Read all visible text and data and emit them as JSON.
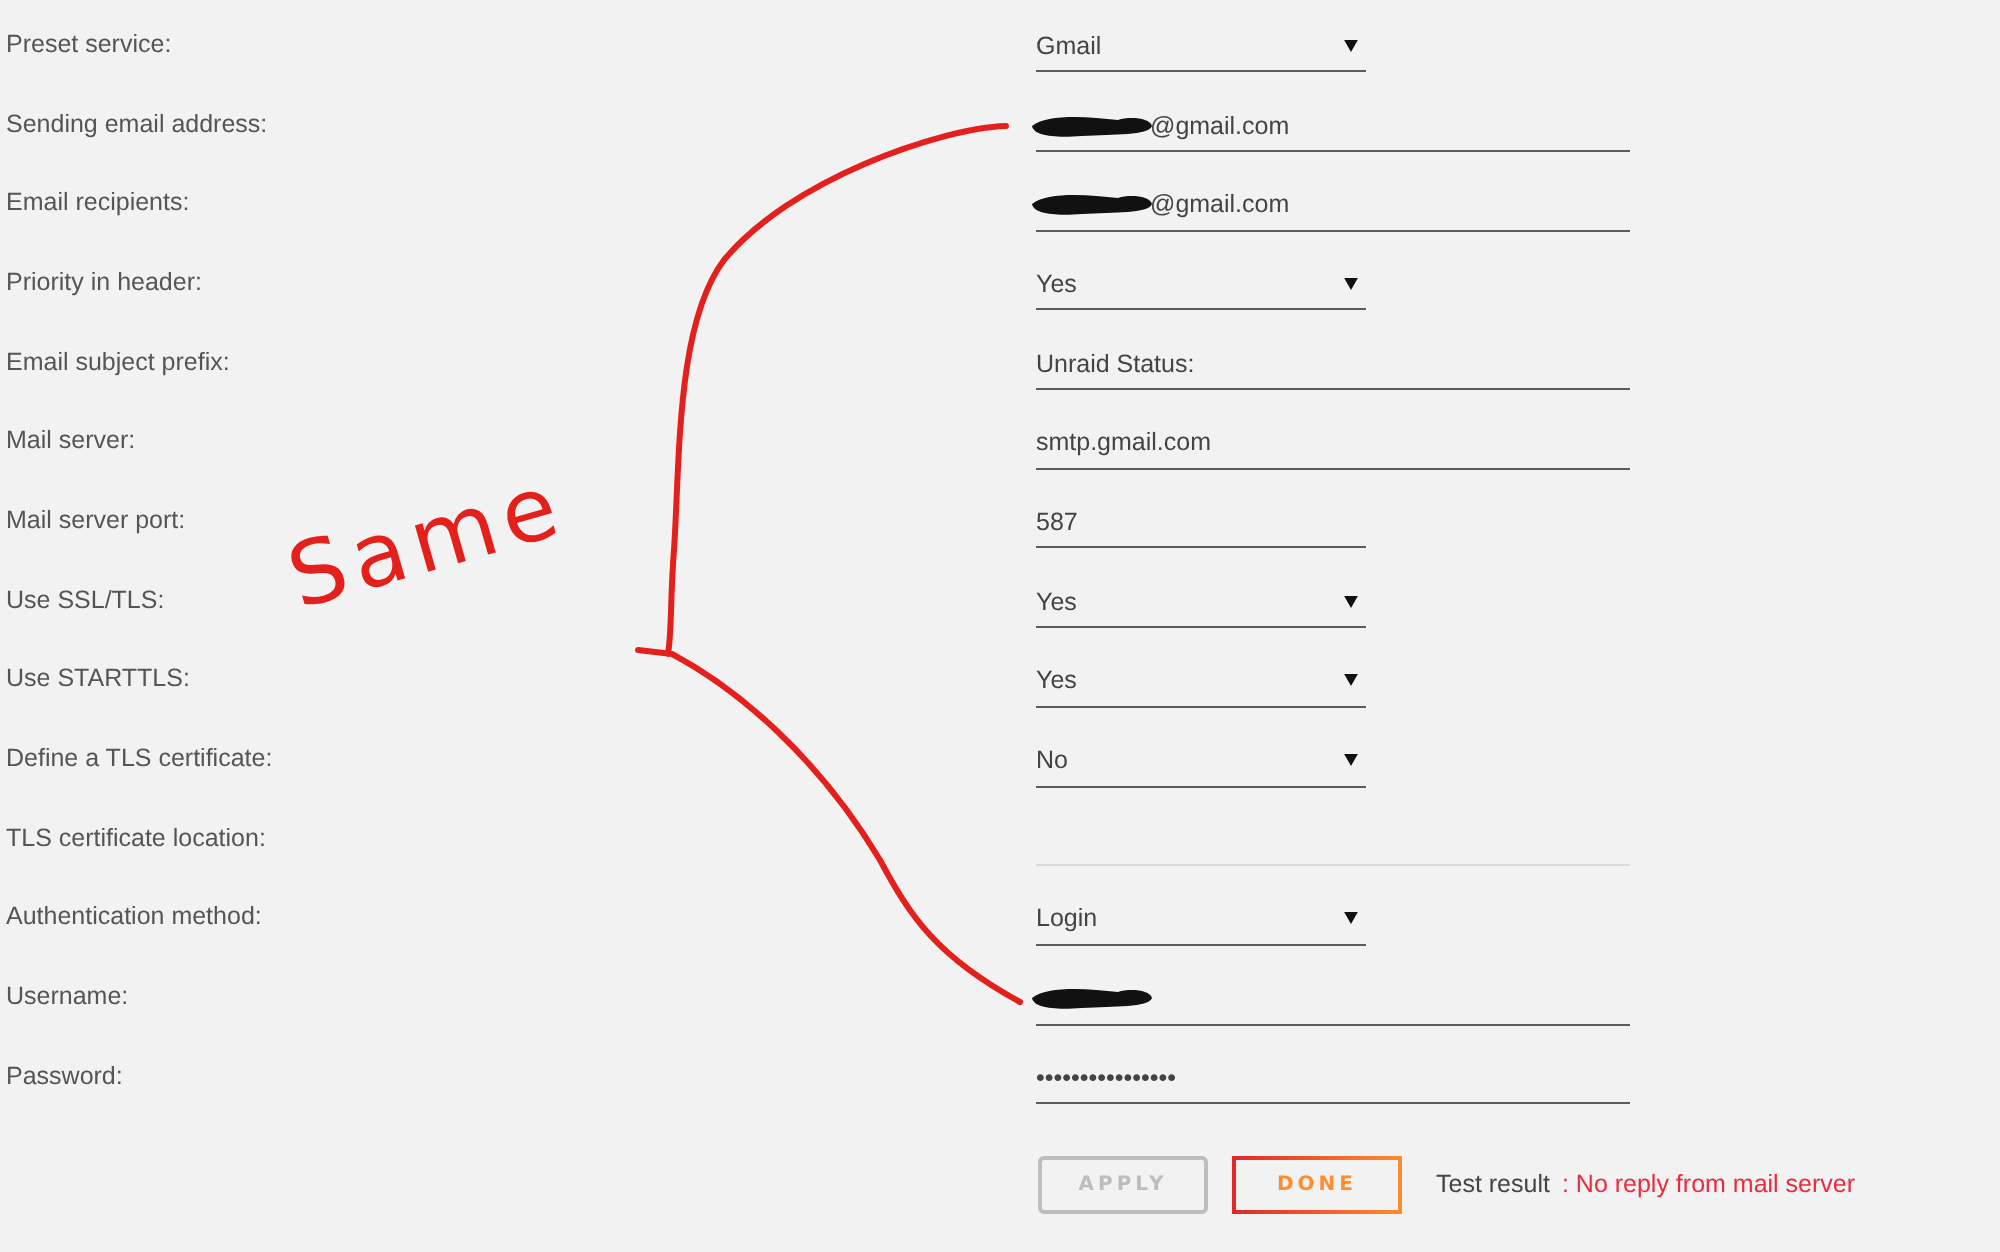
{
  "fields": [
    {
      "label": "Preset service:",
      "kind": "select",
      "value": "Gmail",
      "redacted": false,
      "disabled": false
    },
    {
      "label": "Sending email address:",
      "kind": "text",
      "value": "@gmail.com",
      "redacted": true,
      "disabled": false
    },
    {
      "label": "Email recipients:",
      "kind": "text",
      "value": "@gmail.com",
      "redacted": true,
      "disabled": false
    },
    {
      "label": "Priority in header:",
      "kind": "select",
      "value": "Yes",
      "redacted": false,
      "disabled": false
    },
    {
      "label": "Email subject prefix:",
      "kind": "text",
      "value": "Unraid Status:",
      "redacted": false,
      "disabled": false
    },
    {
      "label": "Mail server:",
      "kind": "text",
      "value": "smtp.gmail.com",
      "redacted": false,
      "disabled": false
    },
    {
      "label": "Mail server port:",
      "kind": "short",
      "value": "587",
      "redacted": false,
      "disabled": false
    },
    {
      "label": "Use SSL/TLS:",
      "kind": "select",
      "value": "Yes",
      "redacted": false,
      "disabled": false
    },
    {
      "label": "Use STARTTLS:",
      "kind": "select",
      "value": "Yes",
      "redacted": false,
      "disabled": false
    },
    {
      "label": "Define a TLS certificate:",
      "kind": "select",
      "value": "No",
      "redacted": false,
      "disabled": false
    },
    {
      "label": "TLS certificate location:",
      "kind": "text",
      "redacted": false,
      "disabled": true
    },
    {
      "label": "Authentication method:",
      "kind": "select",
      "value": "Login",
      "redacted": false,
      "disabled": false
    },
    {
      "label": "Username:",
      "kind": "text",
      "redacted": true,
      "disabled": false
    },
    {
      "label": "Password:",
      "kind": "password",
      "value": "••••••••••••••••",
      "redacted": false,
      "disabled": false
    }
  ],
  "buttons": [
    {
      "label": "APPLY",
      "disabled": true
    },
    {
      "label": "DONE",
      "disabled": false
    }
  ],
  "test_result": {
    "label": "Test result",
    "message": ": No reply from mail server"
  },
  "annotation": {
    "text": "Same"
  }
}
